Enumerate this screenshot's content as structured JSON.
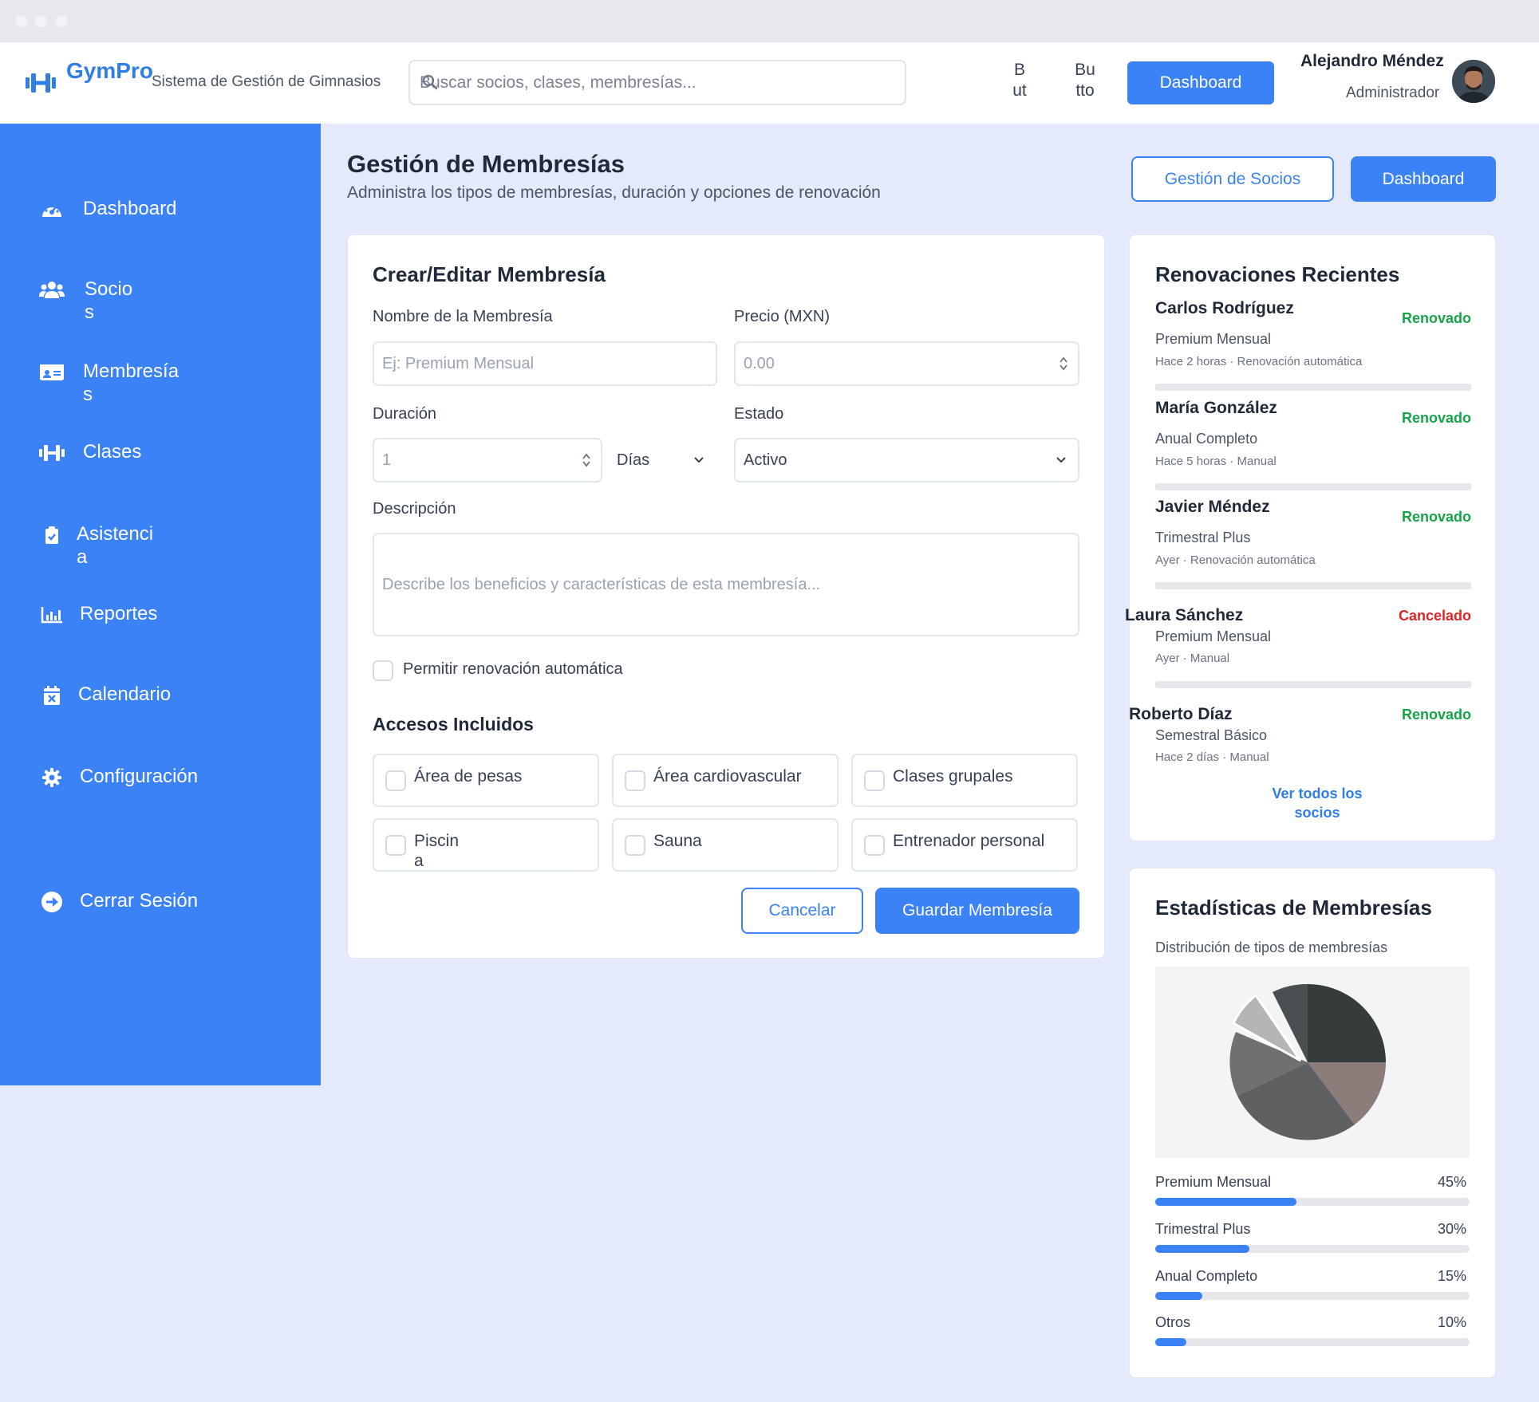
{
  "header": {
    "brand": "GymPro",
    "brand_subtitle": "Sistema de Gestión de Gimnasios",
    "search_placeholder": "Buscar socios, clases, membresías...",
    "btn_a": "B\nut",
    "btn_b": "Bu\ntto",
    "dashboard_label": "Dashboard",
    "user_name": "Alejandro Méndez",
    "user_role": "Administrador"
  },
  "sidebar": {
    "items": [
      {
        "label": "Dashboard",
        "icon": "gauge-icon"
      },
      {
        "label": "Socio\ns",
        "icon": "users-icon"
      },
      {
        "label": "Membresía\ns",
        "icon": "id-card-icon"
      },
      {
        "label": "Clases",
        "icon": "dumbbell-icon"
      },
      {
        "label": "Asistenci\na",
        "icon": "clipboard-check-icon"
      },
      {
        "label": "Reportes",
        "icon": "chart-bar-icon"
      },
      {
        "label": "Calendario",
        "icon": "calendar-x-icon"
      },
      {
        "label": "Configuración",
        "icon": "gear-icon"
      },
      {
        "label": "Cerrar Sesión",
        "icon": "sign-out-icon"
      }
    ]
  },
  "page": {
    "title": "Gestión de Membresías",
    "subtitle": "Administra los tipos de membresías, duración y opciones de renovación",
    "btn_socios": "Gestión de Socios",
    "btn_dashboard": "Dashboard"
  },
  "form": {
    "title": "Crear/Editar Membresía",
    "name_label": "Nombre de la Membresía",
    "name_placeholder": "Ej: Premium Mensual",
    "price_label": "Precio (MXN)",
    "price_placeholder": "0.00",
    "duration_label": "Duración",
    "duration_value": "1",
    "duration_unit": "Días",
    "status_label": "Estado",
    "status_value": "Activo",
    "description_label": "Descripción",
    "description_placeholder": "Describe los beneficios y características de esta membresía...",
    "auto_renew_label": "Permitir renovación automática",
    "access_title": "Accesos Incluidos",
    "access": [
      "Área de pesas",
      "Área cardiovascular",
      "Clases grupales",
      "Piscin\na",
      "Sauna",
      "Entrenador personal"
    ],
    "cancel_label": "Cancelar",
    "save_label": "Guardar Membresía"
  },
  "renewals": {
    "title": "Renovaciones Recientes",
    "items": [
      {
        "name": "Carlos Rodríguez",
        "status": "Renovado",
        "status_color": "#16a34a",
        "plan": "Premium Mensual",
        "meta": "Hace 2 horas · Renovación automática"
      },
      {
        "name": "María González",
        "status": "Renovado",
        "status_color": "#16a34a",
        "plan": "Anual Completo",
        "meta": "Hace 5 horas · Manual"
      },
      {
        "name": "Javier Méndez",
        "status": "Renovado",
        "status_color": "#16a34a",
        "plan": "Trimestral Plus",
        "meta": "Ayer · Renovación automática"
      },
      {
        "name": "Laura Sánchez",
        "status": "Cancelado",
        "status_color": "#dc2626",
        "plan": "Premium Mensual",
        "meta": "Ayer · Manual"
      },
      {
        "name": "Roberto Díaz",
        "status": "Renovado",
        "status_color": "#16a34a",
        "plan": "Semestral Básico",
        "meta": "Hace 2 días · Manual"
      }
    ],
    "view_all": "Ver todos los\nsocios"
  },
  "stats": {
    "title": "Estadísticas de Membresías",
    "subtitle": "Distribución de tipos de membresías",
    "rows": [
      {
        "label": "Premium Mensual",
        "pct_label": "45%",
        "value": 45
      },
      {
        "label": "Trimestral Plus",
        "pct_label": "30%",
        "value": 30
      },
      {
        "label": "Anual Completo",
        "pct_label": "15%",
        "value": 15
      },
      {
        "label": "Otros",
        "pct_label": "10%",
        "value": 10
      }
    ]
  },
  "colors": {
    "primary": "#3b82f6",
    "page_bg": "#e4e9fb",
    "renewed": "#16a34a",
    "cancelled": "#dc2626"
  }
}
